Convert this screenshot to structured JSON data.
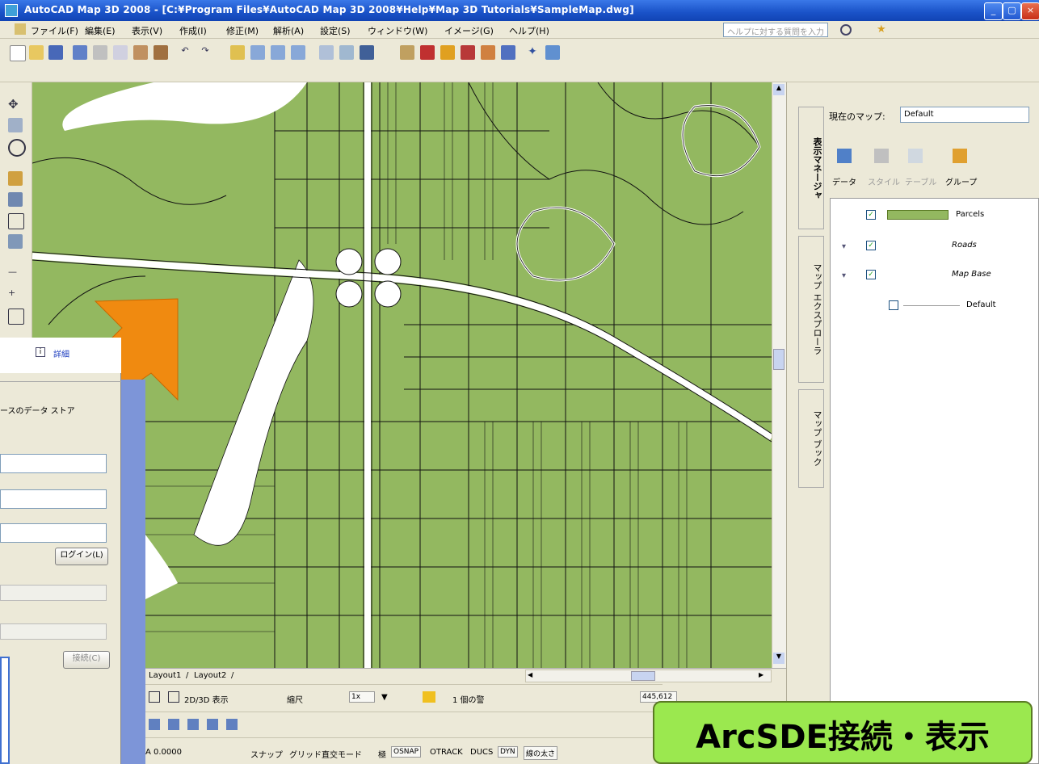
{
  "window": {
    "title": "AutoCAD Map 3D 2008 - [C:¥Program Files¥AutoCAD Map 3D 2008¥Help¥Map 3D Tutorials¥SampleMap.dwg]"
  },
  "menubar": {
    "items": [
      "ファイル(F)",
      "編集(E)",
      "表示(V)",
      "作成(I)",
      "修正(M)",
      "解析(A)",
      "設定(S)",
      "ウィンドウ(W)",
      "イメージ(G)",
      "ヘルプ(H)"
    ],
    "help_placeholder": "ヘルプに対する質問を入力"
  },
  "right_panel": {
    "current_map_label": "現在のマップ:",
    "current_map_value": "Default",
    "tabs": [
      "表示マネージャ",
      "マップ エクスプローラ",
      "マップ ブック"
    ],
    "toolbar": [
      "データ",
      "スタイル",
      "テーブル",
      "グループ"
    ],
    "layers": [
      {
        "name": "Parcels",
        "checked": true
      },
      {
        "name": "Roads",
        "checked": true
      },
      {
        "name": "Map Base",
        "checked": true
      },
      {
        "name": "Default",
        "checked": false
      }
    ]
  },
  "dialog": {
    "detail_link": "詳細",
    "description": "ースのデータ ストア",
    "login_button": "ログイン(L)",
    "connect_button": "接続(C)"
  },
  "layout_tabs": [
    "Layout1",
    "Layout2"
  ],
  "status": {
    "view_mode": "2D/3D 表示",
    "scale_label": "縮尺",
    "scale_value": "1x",
    "warning": "1 個の警",
    "coords": "445,612",
    "coord_value": "A 0.0000",
    "toggles": [
      "スナップ",
      "グリッド",
      "直交モード",
      "極",
      "OSNAP",
      "OTRACK",
      "DUCS",
      "DYN",
      "線の太さ"
    ]
  },
  "callout": {
    "text": "ArcSDE接続・表示"
  },
  "colors": {
    "parcel_fill": "#93b860",
    "arrow": "#f08a10",
    "callout_bg": "#9be84f"
  }
}
